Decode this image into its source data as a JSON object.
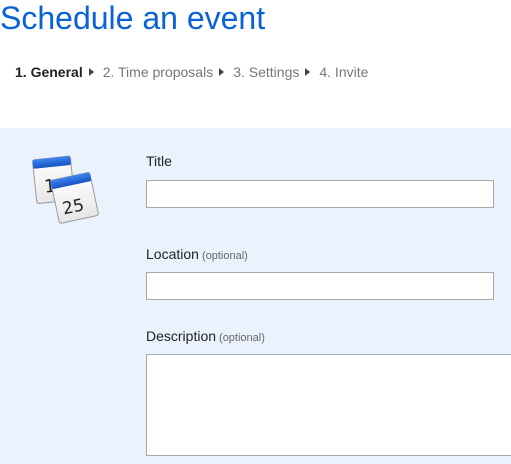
{
  "page": {
    "title": "Schedule an event"
  },
  "steps": [
    {
      "label": "1. General",
      "active": true
    },
    {
      "label": "2. Time proposals",
      "active": false
    },
    {
      "label": "3. Settings",
      "active": false
    },
    {
      "label": "4. Invite",
      "active": false
    }
  ],
  "calendar_icon": {
    "back_day": "1",
    "front_day": "25",
    "accent_color": "#1a5fd0"
  },
  "form": {
    "title_label": "Title",
    "title_value": "",
    "location_label": "Location",
    "location_optional": "(optional)",
    "location_value": "",
    "description_label": "Description",
    "description_optional": "(optional)",
    "description_value": ""
  }
}
